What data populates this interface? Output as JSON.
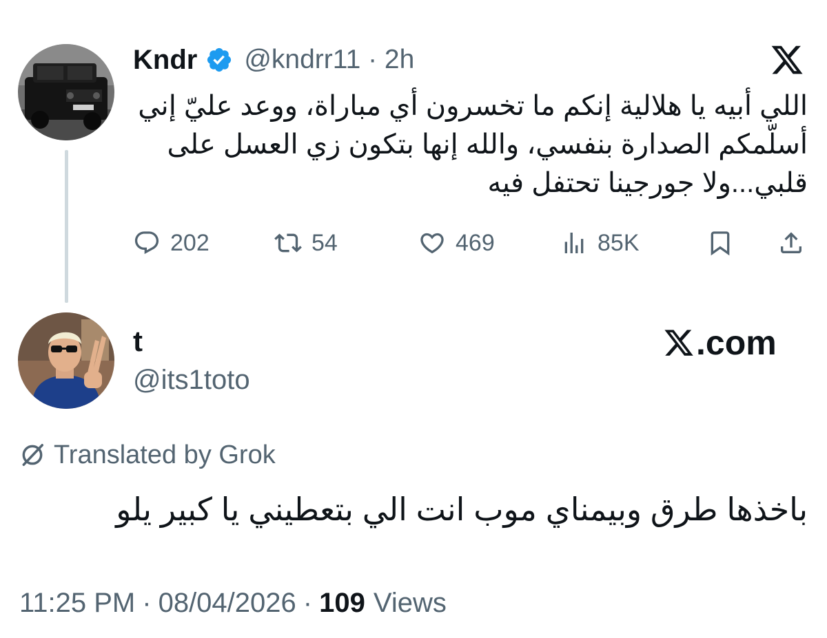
{
  "quoted_tweet": {
    "avatar_icon": "black-suv-avatar",
    "name": "Kndr",
    "verified_icon": "verified-badge-icon",
    "handle": "@kndrr11 · 2h",
    "platform_icon": "x-logo-icon",
    "text": "اللي أبيه يا هلالية إنكم ما تخسرون أي مباراة، ووعد عليّ إني أسلّمكم الصدارة بنفسي، والله إنها بتكون زي العسل على قلبي...ولا جورجينا تحتفل فيه",
    "actions": {
      "replies": "202",
      "reposts": "54",
      "likes": "469",
      "views": "85K"
    }
  },
  "reply_tweet": {
    "avatar_icon": "person-sunglasses-avatar",
    "name": "t",
    "handle": "@its1toto",
    "watermark": ".com",
    "translated_label": "Translated by Grok",
    "text": "باخذها طرق وبيمناي موب انت الي بتعطيني يا كبير يلو",
    "timestamp": "11:25 PM",
    "date": "08/04/2026",
    "views_count": "109",
    "views_label": "Views"
  },
  "colors": {
    "text_primary": "#0f1419",
    "text_secondary": "#536471",
    "verified_blue": "#1d9bf0",
    "thread_line": "#cfd9de"
  }
}
